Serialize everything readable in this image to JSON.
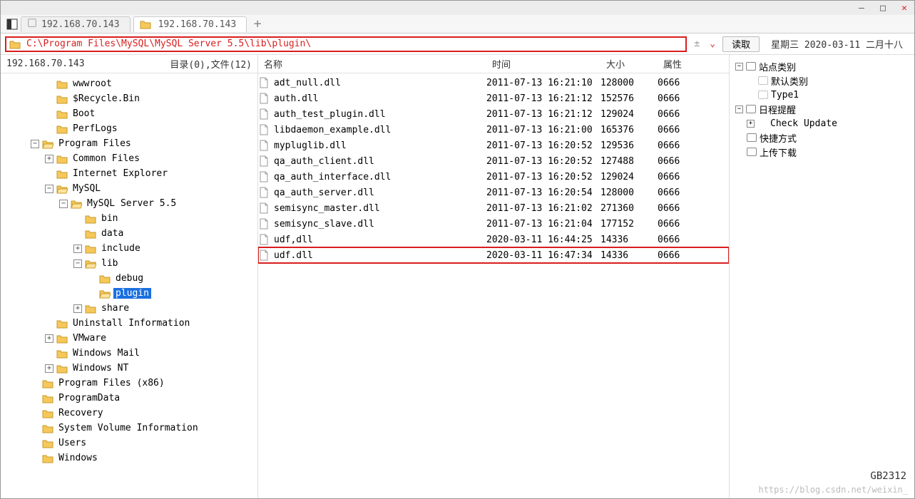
{
  "tabs": {
    "app_icon": "app",
    "inactive": "192.168.70.143",
    "active": "192.168.70.143"
  },
  "address": {
    "path": "C:\\Program Files\\MySQL\\MySQL Server 5.5\\lib\\plugin\\",
    "read_label": "读取",
    "date_info": "星期三 2020-03-11 二月十八"
  },
  "tree_header": {
    "ip": "192.168.70.143",
    "stats": "目录(0),文件(12)"
  },
  "tree": {
    "n0": "wwwroot",
    "n1": "$Recycle.Bin",
    "n2": "Boot",
    "n3": "PerfLogs",
    "n4": "Program Files",
    "n5": "Common Files",
    "n6": "Internet Explorer",
    "n7": "MySQL",
    "n8": "MySQL Server 5.5",
    "n9": "bin",
    "n10": "data",
    "n11": "include",
    "n12": "lib",
    "n13": "debug",
    "n14": "plugin",
    "n15": "share",
    "n16": "Uninstall Information",
    "n17": "VMware",
    "n18": "Windows Mail",
    "n19": "Windows NT",
    "n20": "Program Files (x86)",
    "n21": "ProgramData",
    "n22": "Recovery",
    "n23": "System Volume Information",
    "n24": "Users",
    "n25": "Windows"
  },
  "list": {
    "h_name": "名称",
    "h_time": "时间",
    "h_size": "大小",
    "h_attr": "属性",
    "rows": [
      {
        "name": "adt_null.dll",
        "time": "2011-07-13 16:21:10",
        "size": "128000",
        "attr": "0666"
      },
      {
        "name": "auth.dll",
        "time": "2011-07-13 16:21:12",
        "size": "152576",
        "attr": "0666"
      },
      {
        "name": "auth_test_plugin.dll",
        "time": "2011-07-13 16:21:12",
        "size": "129024",
        "attr": "0666"
      },
      {
        "name": "libdaemon_example.dll",
        "time": "2011-07-13 16:21:00",
        "size": "165376",
        "attr": "0666"
      },
      {
        "name": "mypluglib.dll",
        "time": "2011-07-13 16:20:52",
        "size": "129536",
        "attr": "0666"
      },
      {
        "name": "qa_auth_client.dll",
        "time": "2011-07-13 16:20:52",
        "size": "127488",
        "attr": "0666"
      },
      {
        "name": "qa_auth_interface.dll",
        "time": "2011-07-13 16:20:52",
        "size": "129024",
        "attr": "0666"
      },
      {
        "name": "qa_auth_server.dll",
        "time": "2011-07-13 16:20:54",
        "size": "128000",
        "attr": "0666"
      },
      {
        "name": "semisync_master.dll",
        "time": "2011-07-13 16:21:02",
        "size": "271360",
        "attr": "0666"
      },
      {
        "name": "semisync_slave.dll",
        "time": "2011-07-13 16:21:04",
        "size": "177152",
        "attr": "0666"
      },
      {
        "name": "udf,dll",
        "time": "2020-03-11 16:44:25",
        "size": "14336",
        "attr": "0666"
      },
      {
        "name": "udf.dll",
        "time": "2020-03-11 16:47:34",
        "size": "14336",
        "attr": "0666",
        "hl": true
      }
    ]
  },
  "sidebar": {
    "s0": "站点类别",
    "s1": "默认类别",
    "s2": "Type1",
    "s3": "日程提醒",
    "s4": "Check Update",
    "s5": "快捷方式",
    "s6": "上传下载"
  },
  "footer": {
    "watermark": "https://blog.csdn.net/weixin_",
    "encoding": "GB2312"
  }
}
